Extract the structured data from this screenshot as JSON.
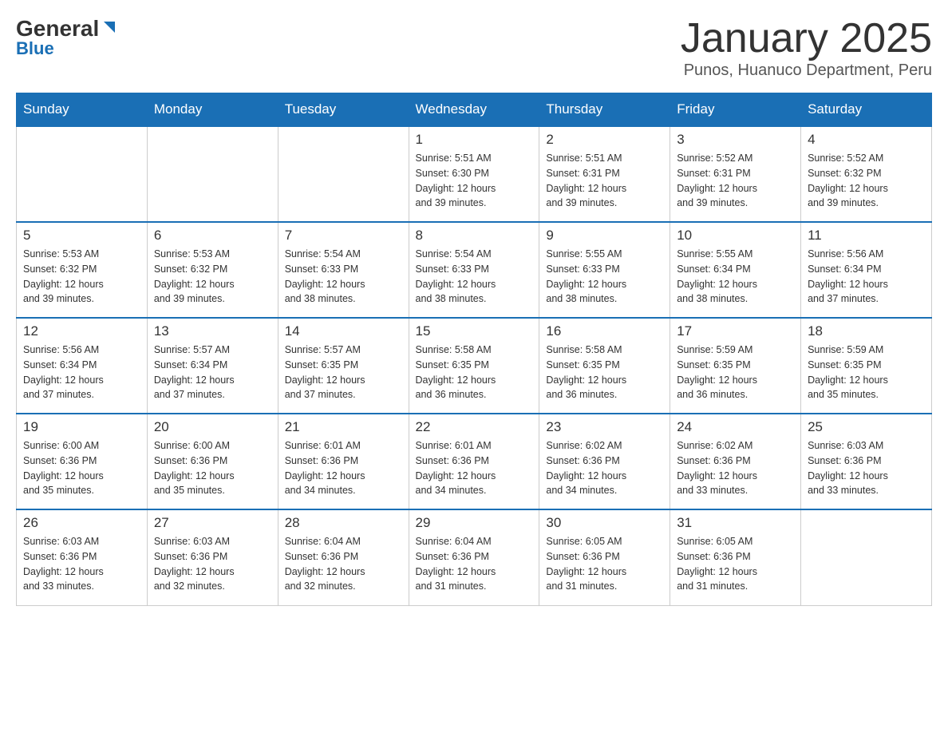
{
  "header": {
    "logo_general": "General",
    "logo_blue": "Blue",
    "title": "January 2025",
    "subtitle": "Punos, Huanuco Department, Peru"
  },
  "days_of_week": [
    "Sunday",
    "Monday",
    "Tuesday",
    "Wednesday",
    "Thursday",
    "Friday",
    "Saturday"
  ],
  "weeks": [
    [
      {
        "day": "",
        "info": ""
      },
      {
        "day": "",
        "info": ""
      },
      {
        "day": "",
        "info": ""
      },
      {
        "day": "1",
        "info": "Sunrise: 5:51 AM\nSunset: 6:30 PM\nDaylight: 12 hours\nand 39 minutes."
      },
      {
        "day": "2",
        "info": "Sunrise: 5:51 AM\nSunset: 6:31 PM\nDaylight: 12 hours\nand 39 minutes."
      },
      {
        "day": "3",
        "info": "Sunrise: 5:52 AM\nSunset: 6:31 PM\nDaylight: 12 hours\nand 39 minutes."
      },
      {
        "day": "4",
        "info": "Sunrise: 5:52 AM\nSunset: 6:32 PM\nDaylight: 12 hours\nand 39 minutes."
      }
    ],
    [
      {
        "day": "5",
        "info": "Sunrise: 5:53 AM\nSunset: 6:32 PM\nDaylight: 12 hours\nand 39 minutes."
      },
      {
        "day": "6",
        "info": "Sunrise: 5:53 AM\nSunset: 6:32 PM\nDaylight: 12 hours\nand 39 minutes."
      },
      {
        "day": "7",
        "info": "Sunrise: 5:54 AM\nSunset: 6:33 PM\nDaylight: 12 hours\nand 38 minutes."
      },
      {
        "day": "8",
        "info": "Sunrise: 5:54 AM\nSunset: 6:33 PM\nDaylight: 12 hours\nand 38 minutes."
      },
      {
        "day": "9",
        "info": "Sunrise: 5:55 AM\nSunset: 6:33 PM\nDaylight: 12 hours\nand 38 minutes."
      },
      {
        "day": "10",
        "info": "Sunrise: 5:55 AM\nSunset: 6:34 PM\nDaylight: 12 hours\nand 38 minutes."
      },
      {
        "day": "11",
        "info": "Sunrise: 5:56 AM\nSunset: 6:34 PM\nDaylight: 12 hours\nand 37 minutes."
      }
    ],
    [
      {
        "day": "12",
        "info": "Sunrise: 5:56 AM\nSunset: 6:34 PM\nDaylight: 12 hours\nand 37 minutes."
      },
      {
        "day": "13",
        "info": "Sunrise: 5:57 AM\nSunset: 6:34 PM\nDaylight: 12 hours\nand 37 minutes."
      },
      {
        "day": "14",
        "info": "Sunrise: 5:57 AM\nSunset: 6:35 PM\nDaylight: 12 hours\nand 37 minutes."
      },
      {
        "day": "15",
        "info": "Sunrise: 5:58 AM\nSunset: 6:35 PM\nDaylight: 12 hours\nand 36 minutes."
      },
      {
        "day": "16",
        "info": "Sunrise: 5:58 AM\nSunset: 6:35 PM\nDaylight: 12 hours\nand 36 minutes."
      },
      {
        "day": "17",
        "info": "Sunrise: 5:59 AM\nSunset: 6:35 PM\nDaylight: 12 hours\nand 36 minutes."
      },
      {
        "day": "18",
        "info": "Sunrise: 5:59 AM\nSunset: 6:35 PM\nDaylight: 12 hours\nand 35 minutes."
      }
    ],
    [
      {
        "day": "19",
        "info": "Sunrise: 6:00 AM\nSunset: 6:36 PM\nDaylight: 12 hours\nand 35 minutes."
      },
      {
        "day": "20",
        "info": "Sunrise: 6:00 AM\nSunset: 6:36 PM\nDaylight: 12 hours\nand 35 minutes."
      },
      {
        "day": "21",
        "info": "Sunrise: 6:01 AM\nSunset: 6:36 PM\nDaylight: 12 hours\nand 34 minutes."
      },
      {
        "day": "22",
        "info": "Sunrise: 6:01 AM\nSunset: 6:36 PM\nDaylight: 12 hours\nand 34 minutes."
      },
      {
        "day": "23",
        "info": "Sunrise: 6:02 AM\nSunset: 6:36 PM\nDaylight: 12 hours\nand 34 minutes."
      },
      {
        "day": "24",
        "info": "Sunrise: 6:02 AM\nSunset: 6:36 PM\nDaylight: 12 hours\nand 33 minutes."
      },
      {
        "day": "25",
        "info": "Sunrise: 6:03 AM\nSunset: 6:36 PM\nDaylight: 12 hours\nand 33 minutes."
      }
    ],
    [
      {
        "day": "26",
        "info": "Sunrise: 6:03 AM\nSunset: 6:36 PM\nDaylight: 12 hours\nand 33 minutes."
      },
      {
        "day": "27",
        "info": "Sunrise: 6:03 AM\nSunset: 6:36 PM\nDaylight: 12 hours\nand 32 minutes."
      },
      {
        "day": "28",
        "info": "Sunrise: 6:04 AM\nSunset: 6:36 PM\nDaylight: 12 hours\nand 32 minutes."
      },
      {
        "day": "29",
        "info": "Sunrise: 6:04 AM\nSunset: 6:36 PM\nDaylight: 12 hours\nand 31 minutes."
      },
      {
        "day": "30",
        "info": "Sunrise: 6:05 AM\nSunset: 6:36 PM\nDaylight: 12 hours\nand 31 minutes."
      },
      {
        "day": "31",
        "info": "Sunrise: 6:05 AM\nSunset: 6:36 PM\nDaylight: 12 hours\nand 31 minutes."
      },
      {
        "day": "",
        "info": ""
      }
    ]
  ]
}
